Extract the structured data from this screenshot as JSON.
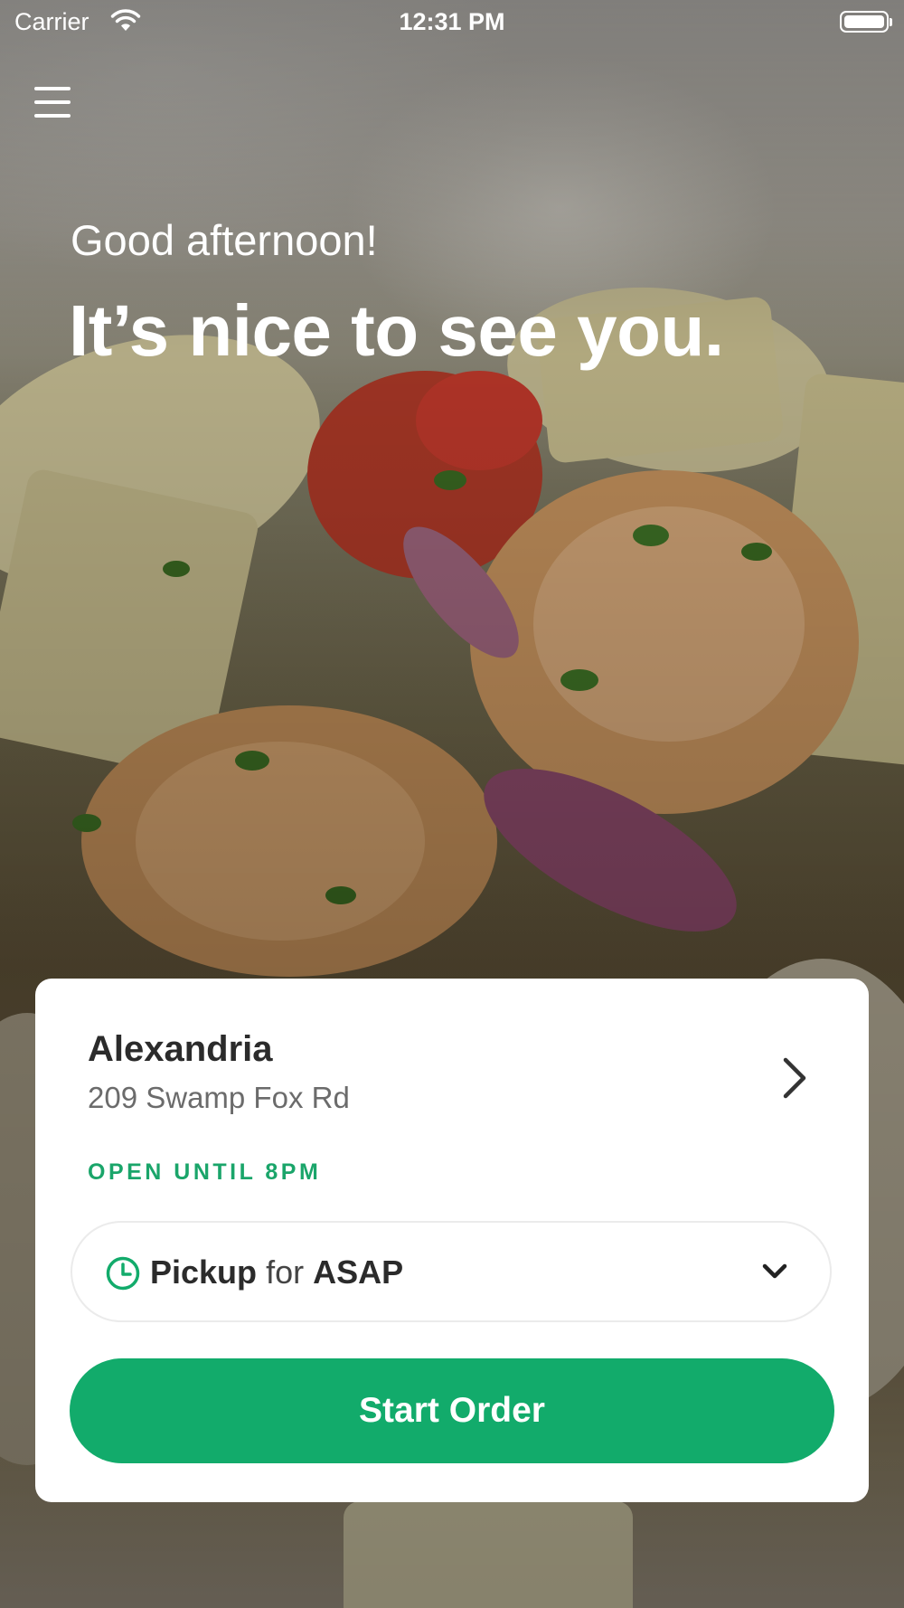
{
  "status_bar": {
    "carrier": "Carrier",
    "time": "12:31 PM"
  },
  "greeting": {
    "subtitle": "Good afternoon!",
    "title": "It’s nice to see you."
  },
  "location": {
    "name": "Alexandria",
    "address": "209 Swamp Fox Rd",
    "hours": "OPEN UNTIL 8PM"
  },
  "order_mode": {
    "mode": "Pickup",
    "connector": "for",
    "time": "ASAP"
  },
  "actions": {
    "start_order": "Start Order"
  },
  "colors": {
    "accent_green": "#12ab6b",
    "status_green": "#1aa56a",
    "card_background": "#ffffff"
  },
  "icons": {
    "menu": "hamburger-menu-icon",
    "location_chevron": "chevron-right-icon",
    "clock": "clock-icon",
    "dropdown": "chevron-down-icon",
    "wifi": "wifi-icon",
    "battery": "battery-icon"
  }
}
